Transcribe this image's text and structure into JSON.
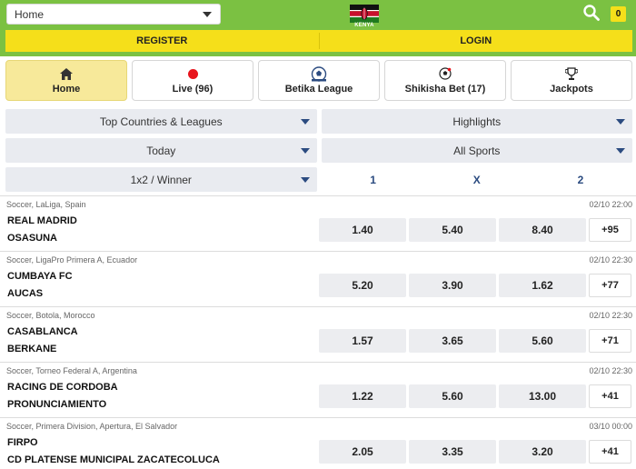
{
  "header": {
    "sport_select_value": "Home",
    "country_label": "KENYA",
    "balance": "0",
    "register_label": "REGISTER",
    "login_label": "LOGIN"
  },
  "colors": {
    "brand_green": "#7bc142",
    "accent_yellow": "#f5df1a",
    "odds_blue": "#2b4b80"
  },
  "nav": {
    "tiles": [
      {
        "label": "Home",
        "icon": "home-icon",
        "active": true
      },
      {
        "label": "Live (96)",
        "icon": "live-dot-icon",
        "active": false
      },
      {
        "label": "Betika League",
        "icon": "league-ball-icon",
        "active": false
      },
      {
        "label": "Shikisha Bet (17)",
        "icon": "soccer-ball-icon",
        "active": false
      },
      {
        "label": "Jackpots",
        "icon": "trophy-icon",
        "active": false
      }
    ]
  },
  "filters": {
    "countries": "Top Countries & Leagues",
    "highlights": "Highlights",
    "day": "Today",
    "sports": "All Sports",
    "market": "1x2 / Winner",
    "odds_headers": [
      "1",
      "X",
      "2"
    ]
  },
  "matches": [
    {
      "league": "Soccer, LaLiga, Spain",
      "time": "02/10 22:00",
      "home": "REAL MADRID",
      "away": "OSASUNA",
      "odds": [
        "1.40",
        "5.40",
        "8.40"
      ],
      "more": "+95"
    },
    {
      "league": "Soccer, LigaPro Primera A, Ecuador",
      "time": "02/10 22:30",
      "home": "CUMBAYA FC",
      "away": "AUCAS",
      "odds": [
        "5.20",
        "3.90",
        "1.62"
      ],
      "more": "+77"
    },
    {
      "league": "Soccer, Botola, Morocco",
      "time": "02/10 22:30",
      "home": "CASABLANCA",
      "away": "BERKANE",
      "odds": [
        "1.57",
        "3.65",
        "5.60"
      ],
      "more": "+71"
    },
    {
      "league": "Soccer, Torneo Federal A, Argentina",
      "time": "02/10 22:30",
      "home": "RACING DE CORDOBA",
      "away": "PRONUNCIAMIENTO",
      "odds": [
        "1.22",
        "5.60",
        "13.00"
      ],
      "more": "+41"
    },
    {
      "league": "Soccer, Primera Division, Apertura, El Salvador",
      "time": "03/10 00:00",
      "home": "FIRPO",
      "away": "CD PLATENSE MUNICIPAL ZACATECOLUCA",
      "odds": [
        "2.05",
        "3.35",
        "3.20"
      ],
      "more": "+41"
    }
  ]
}
